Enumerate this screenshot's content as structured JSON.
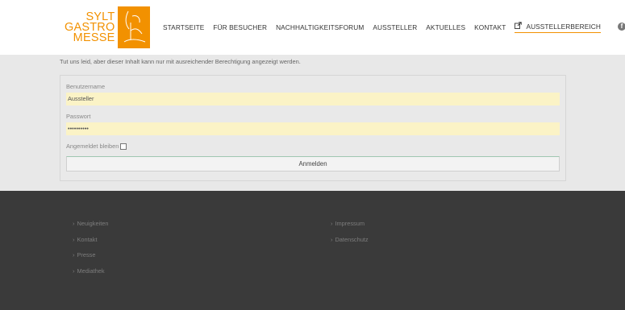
{
  "header": {
    "logo": {
      "line1": "SYLT",
      "line2": "GASTRO",
      "line3": "MESSE"
    },
    "nav": [
      {
        "label": "STARTSEITE"
      },
      {
        "label": "FÜR BESUCHER"
      },
      {
        "label": "NACHHALTIGKEITSFORUM"
      },
      {
        "label": "AUSSTELLER"
      },
      {
        "label": "AKTUELLES"
      },
      {
        "label": "KONTAKT"
      }
    ],
    "special_nav": {
      "label": "AUSSTELLERBEREICH",
      "icon": "external-link-icon"
    },
    "social_icon": "facebook-icon",
    "accent_color": "#f29100"
  },
  "main": {
    "notice": "Tut uns leid, aber dieser Inhalt kann nur mit ausreichender Berechtigung angezeigt werden.",
    "login": {
      "username_label": "Benutzername",
      "username_value": "Aussteller",
      "password_label": "Passwort",
      "password_value": "••••••••••",
      "remember_label": "Angemeldet bleiben",
      "submit_label": "Anmelden"
    }
  },
  "footer": {
    "col1": [
      {
        "label": "Neuigkeiten"
      },
      {
        "label": "Kontakt"
      },
      {
        "label": "Presse"
      },
      {
        "label": "Mediathek"
      }
    ],
    "col2": [
      {
        "label": "Impressum"
      },
      {
        "label": "Datenschutz"
      }
    ]
  }
}
